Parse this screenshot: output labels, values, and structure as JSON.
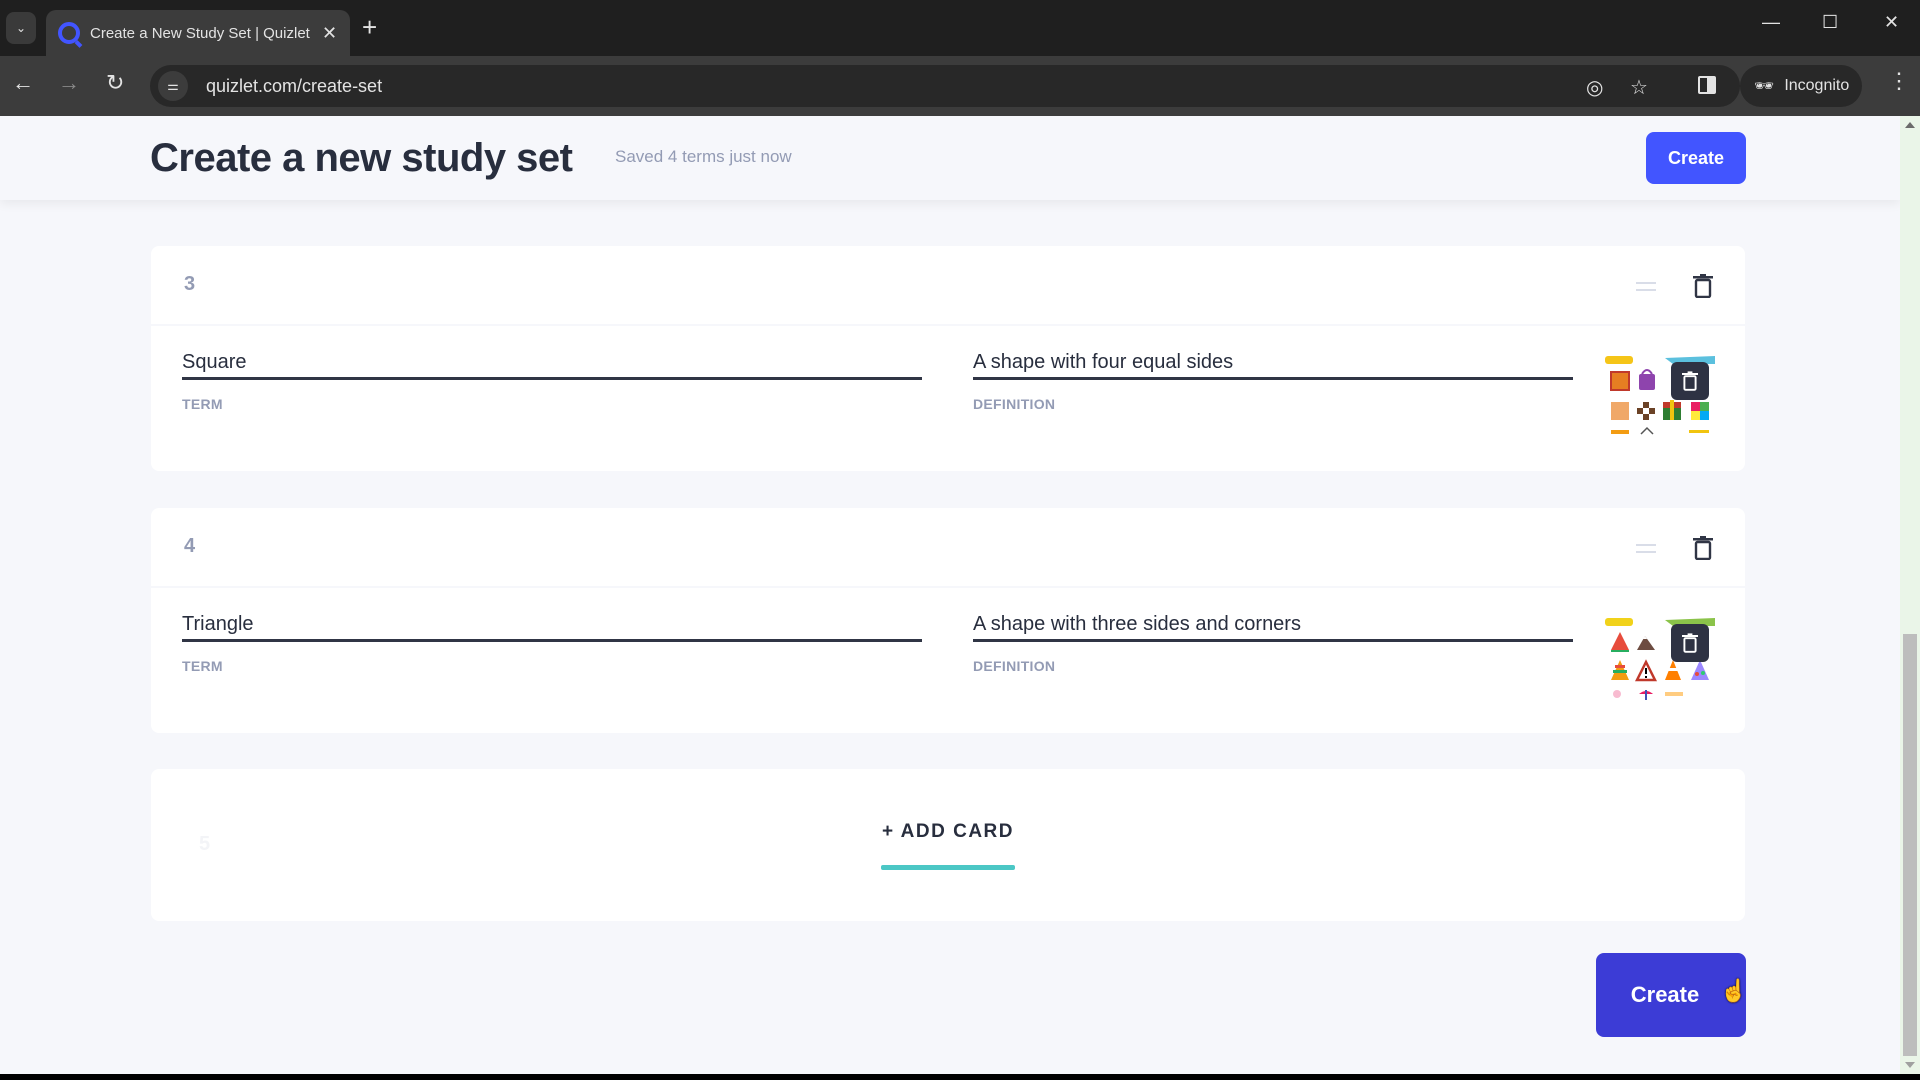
{
  "browser": {
    "tab_title": "Create a New Study Set | Quizlet",
    "url": "quizlet.com/create-set",
    "incognito_label": "Incognito",
    "icons": {
      "tab_search": "chevron-down-icon",
      "favicon": "quizlet-q-icon",
      "tab_close": "close-icon",
      "new_tab": "plus-icon",
      "minimize": "minimize-icon",
      "maximize": "maximize-icon",
      "close_window": "close-icon",
      "back": "arrow-left-icon",
      "forward": "arrow-right-icon",
      "reload": "reload-icon",
      "site_info": "tune-icon",
      "tracking": "eye-off-icon",
      "bookmark": "star-icon",
      "side_panel": "side-panel-icon",
      "incognito": "incognito-icon",
      "menu": "more-vert-icon"
    },
    "glyphs": {
      "tab_search": "⌄",
      "tab_close": "✕",
      "new_tab": "+",
      "minimize": "—",
      "maximize": "☐",
      "close_window": "✕",
      "back": "←",
      "forward": "→",
      "reload": "↻",
      "site_info": "⚌",
      "tracking": "◎",
      "bookmark": "☆",
      "incognito": "🕶",
      "menu": "⋮"
    }
  },
  "header": {
    "title": "Create a new study set",
    "save_status": "Saved 4 terms just now",
    "create_label": "Create"
  },
  "cards": [
    {
      "number": "3",
      "term": "Square",
      "term_label": "TERM",
      "definition": "A shape with four equal sides",
      "definition_label": "DEFINITION",
      "image": "square-objects-collage"
    },
    {
      "number": "4",
      "term": "Triangle",
      "term_label": "TERM",
      "definition": "A shape with three sides and corners",
      "definition_label": "DEFINITION",
      "image": "triangle-objects-collage"
    }
  ],
  "add_card": {
    "next_number": "5",
    "label": "+ ADD CARD"
  },
  "footer": {
    "create_label": "Create"
  },
  "colors": {
    "brand_blue": "#4255ff",
    "create_bottom": "#3c3cd6",
    "add_card_underline": "#4bc7c5",
    "title_text": "#282e3e",
    "muted_text": "#939bb4",
    "page_bg": "#f6f7fb"
  }
}
